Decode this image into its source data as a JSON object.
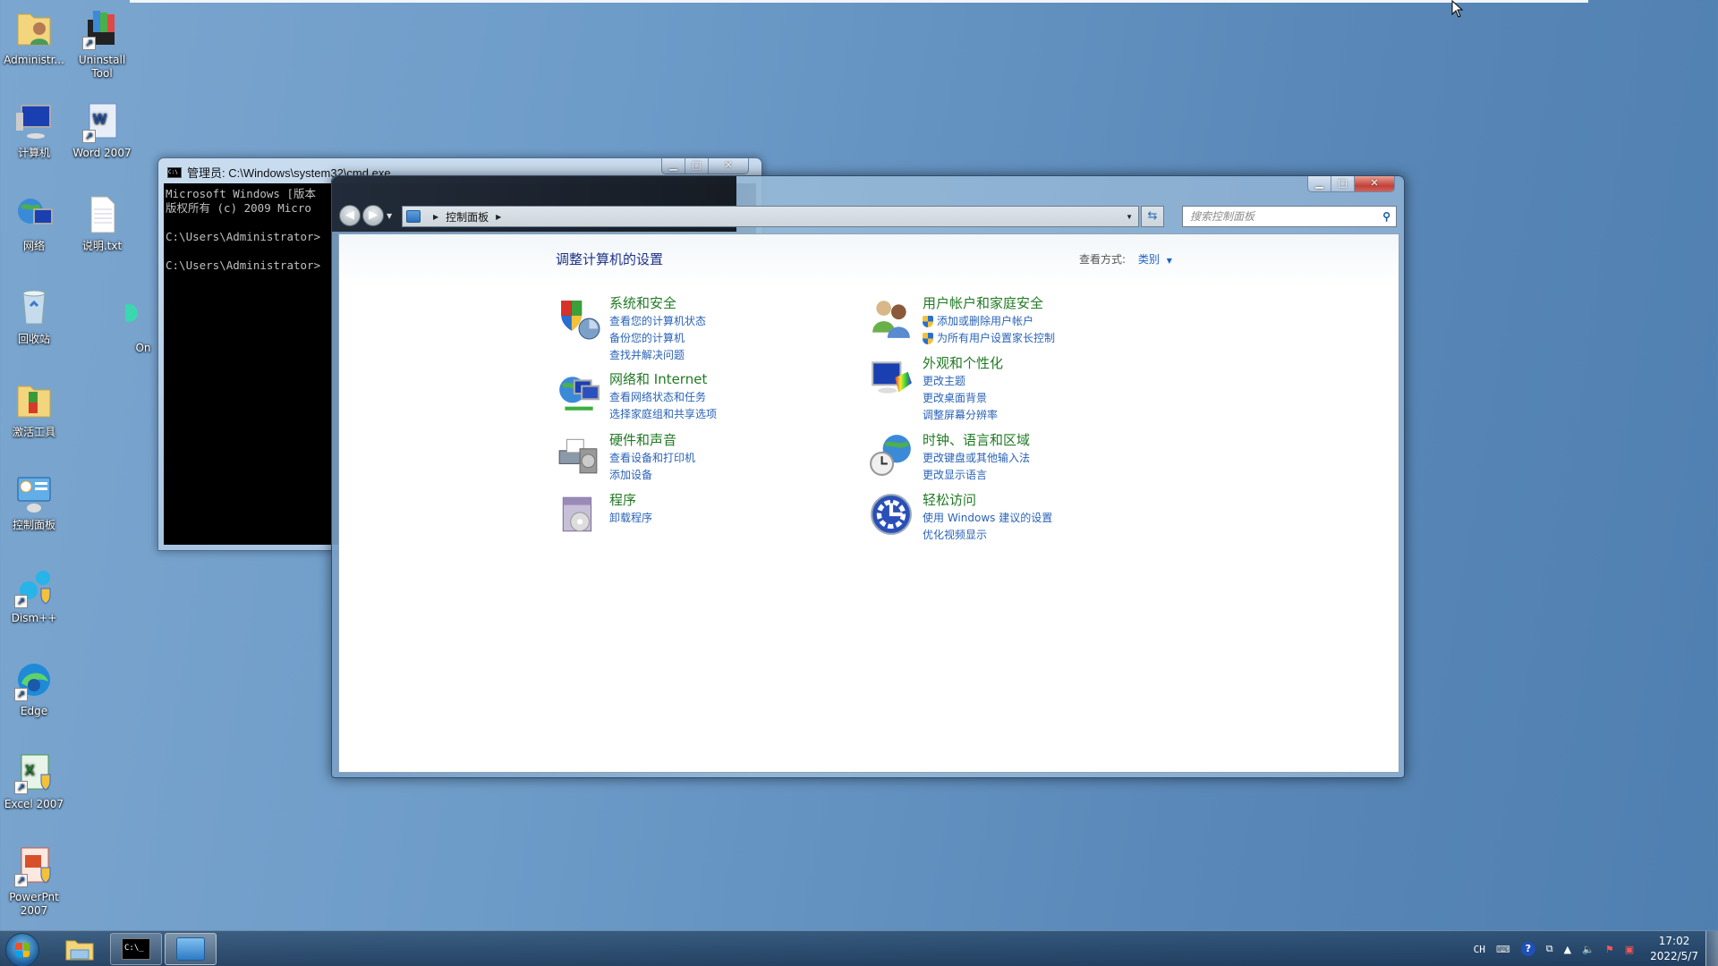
{
  "desktop": {
    "icons": [
      {
        "label": "Administr...",
        "icon": "user-folder-icon"
      },
      {
        "label": "Uninstall Tool",
        "icon": "uninstall-tool-icon",
        "shortcut": true
      },
      {
        "label": "计算机",
        "icon": "computer-icon"
      },
      {
        "label": "Word 2007",
        "icon": "word-icon",
        "shortcut": true
      },
      {
        "label": "网络",
        "icon": "network-icon"
      },
      {
        "label": "说明.txt",
        "icon": "text-file-icon"
      },
      {
        "label": "回收站",
        "icon": "recycle-bin-icon"
      },
      {
        "label": "激活工具",
        "icon": "folder-icon"
      },
      {
        "label": "控制面板",
        "icon": "control-panel-icon"
      },
      {
        "label": "Dism++",
        "icon": "dism-gear-icon",
        "shortcut": true
      },
      {
        "label": "Edge",
        "icon": "edge-icon",
        "shortcut": true
      },
      {
        "label": "Excel 2007",
        "icon": "excel-icon",
        "shortcut": true
      },
      {
        "label": "PowerPnt 2007",
        "icon": "powerpoint-icon",
        "shortcut": true
      },
      {
        "label": "On",
        "icon": "partial-icon"
      }
    ]
  },
  "cmd": {
    "title": "管理员: C:\\Windows\\system32\\cmd.exe",
    "lines": [
      "Microsoft Windows [版本",
      "版权所有 (c) 2009 Micro",
      "",
      "C:\\Users\\Administrator>",
      "",
      "C:\\Users\\Administrator>"
    ],
    "minimize_label": "▁",
    "maximize_label": "□",
    "close_label": "✕"
  },
  "control_panel": {
    "breadcrumb": [
      "控制面板"
    ],
    "search_placeholder": "搜索控制面板",
    "heading": "调整计算机的设置",
    "view_by_label": "查看方式:",
    "view_by_value": "类别",
    "categories_left": [
      {
        "title": "系统和安全",
        "icon": "system-security-shield-icon",
        "links": [
          {
            "text": "查看您的计算机状态"
          },
          {
            "text": "备份您的计算机"
          },
          {
            "text": "查找并解决问题"
          }
        ]
      },
      {
        "title": "网络和 Internet",
        "icon": "network-internet-icon",
        "links": [
          {
            "text": "查看网络状态和任务"
          },
          {
            "text": "选择家庭组和共享选项"
          }
        ]
      },
      {
        "title": "硬件和声音",
        "icon": "printer-hardware-icon",
        "links": [
          {
            "text": "查看设备和打印机"
          },
          {
            "text": "添加设备"
          }
        ]
      },
      {
        "title": "程序",
        "icon": "programs-box-icon",
        "links": [
          {
            "text": "卸载程序"
          }
        ]
      }
    ],
    "categories_right": [
      {
        "title": "用户帐户和家庭安全",
        "icon": "user-accounts-icon",
        "links": [
          {
            "text": "添加或删除用户帐户",
            "shield": true
          },
          {
            "text": "为所有用户设置家长控制",
            "shield": true
          }
        ]
      },
      {
        "title": "外观和个性化",
        "icon": "appearance-monitor-icon",
        "links": [
          {
            "text": "更改主题"
          },
          {
            "text": "更改桌面背景"
          },
          {
            "text": "调整屏幕分辨率"
          }
        ]
      },
      {
        "title": "时钟、语言和区域",
        "icon": "clock-globe-icon",
        "links": [
          {
            "text": "更改键盘或其他输入法"
          },
          {
            "text": "更改显示语言"
          }
        ]
      },
      {
        "title": "轻松访问",
        "icon": "ease-of-access-icon",
        "links": [
          {
            "text": "使用 Windows 建议的设置"
          },
          {
            "text": "优化视频显示"
          }
        ]
      }
    ]
  },
  "taskbar": {
    "items": [
      {
        "name": "file-explorer",
        "icon": "folder-icon"
      },
      {
        "name": "cmd",
        "icon": "cmd-icon",
        "label": "C:\\_"
      },
      {
        "name": "control-panel",
        "icon": "control-panel-icon",
        "active": true
      }
    ],
    "tray": {
      "ime": "CH",
      "time": "17:02",
      "date": "2022/5/7"
    }
  },
  "colors": {
    "category_title": "#217a24",
    "link": "#2a63b8",
    "heading": "#1e3287"
  }
}
